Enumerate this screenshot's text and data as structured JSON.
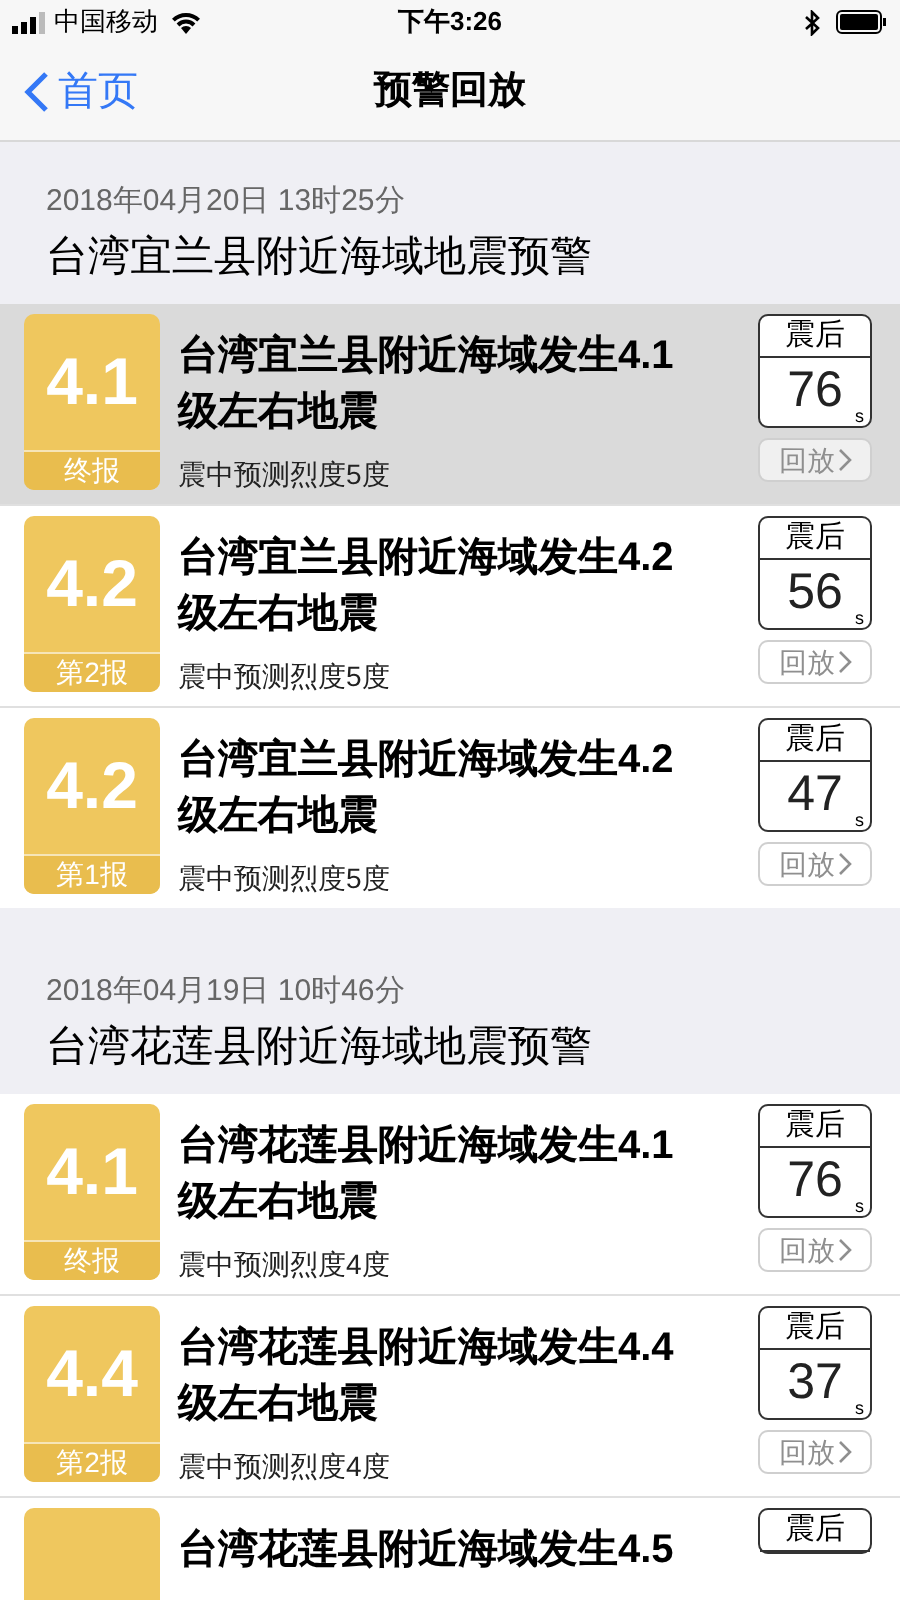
{
  "status_bar": {
    "carrier": "中国移动",
    "time": "下午3:26"
  },
  "nav": {
    "back": "首页",
    "title": "预警回放"
  },
  "sections": [
    {
      "date": "2018年04月20日 13时25分",
      "title": "台湾宜兰县附近海域地震预警",
      "events": [
        {
          "magnitude": "4.1",
          "report": "终报",
          "title": "台湾宜兰县附近海域发生4.1级左右地震",
          "intensity": "震中预测烈度5度",
          "countdown_label": "震后",
          "seconds": "76",
          "unit": "s",
          "replay": "回放",
          "replay_disabled": true,
          "selected": true
        },
        {
          "magnitude": "4.2",
          "report": "第2报",
          "title": "台湾宜兰县附近海域发生4.2级左右地震",
          "intensity": "震中预测烈度5度",
          "countdown_label": "震后",
          "seconds": "56",
          "unit": "s",
          "replay": "回放",
          "replay_disabled": true,
          "selected": false
        },
        {
          "magnitude": "4.2",
          "report": "第1报",
          "title": "台湾宜兰县附近海域发生4.2级左右地震",
          "intensity": "震中预测烈度5度",
          "countdown_label": "震后",
          "seconds": "47",
          "unit": "s",
          "replay": "回放",
          "replay_disabled": true,
          "selected": false
        }
      ]
    },
    {
      "date": "2018年04月19日 10时46分",
      "title": "台湾花莲县附近海域地震预警",
      "events": [
        {
          "magnitude": "4.1",
          "report": "终报",
          "title": "台湾花莲县附近海域发生4.1级左右地震",
          "intensity": "震中预测烈度4度",
          "countdown_label": "震后",
          "seconds": "76",
          "unit": "s",
          "replay": "回放",
          "replay_disabled": true,
          "selected": false
        },
        {
          "magnitude": "4.4",
          "report": "第2报",
          "title": "台湾花莲县附近海域发生4.4级左右地震",
          "intensity": "震中预测烈度4度",
          "countdown_label": "震后",
          "seconds": "37",
          "unit": "s",
          "replay": "回放",
          "replay_disabled": true,
          "selected": false
        },
        {
          "title": "台湾花莲县附近海域发生4.5",
          "countdown_label": "震后",
          "selected": false
        }
      ]
    }
  ]
}
